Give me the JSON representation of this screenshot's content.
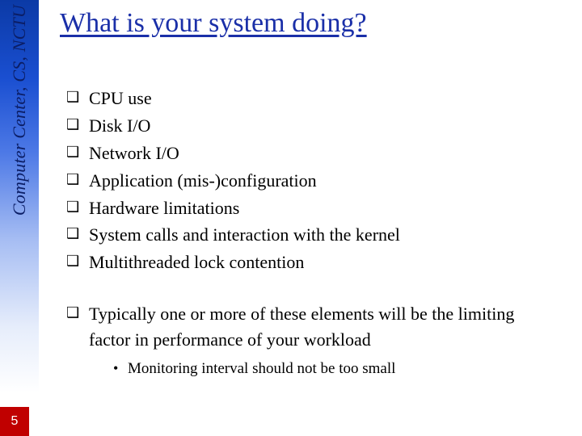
{
  "sidebar": {
    "label": "Computer Center, CS, NCTU"
  },
  "title": "What is your system doing?",
  "bullets_a": [
    "CPU use",
    "Disk I/O",
    "Network I/O",
    "Application (mis-)configuration",
    "Hardware limitations",
    "System calls and interaction with the kernel",
    "Multithreaded lock contention"
  ],
  "bullets_b": [
    {
      "text": "Typically one or more of these elements will be the limiting factor in performance of your workload",
      "sub": [
        "Monitoring interval should not be too small"
      ]
    }
  ],
  "page_number": "5"
}
